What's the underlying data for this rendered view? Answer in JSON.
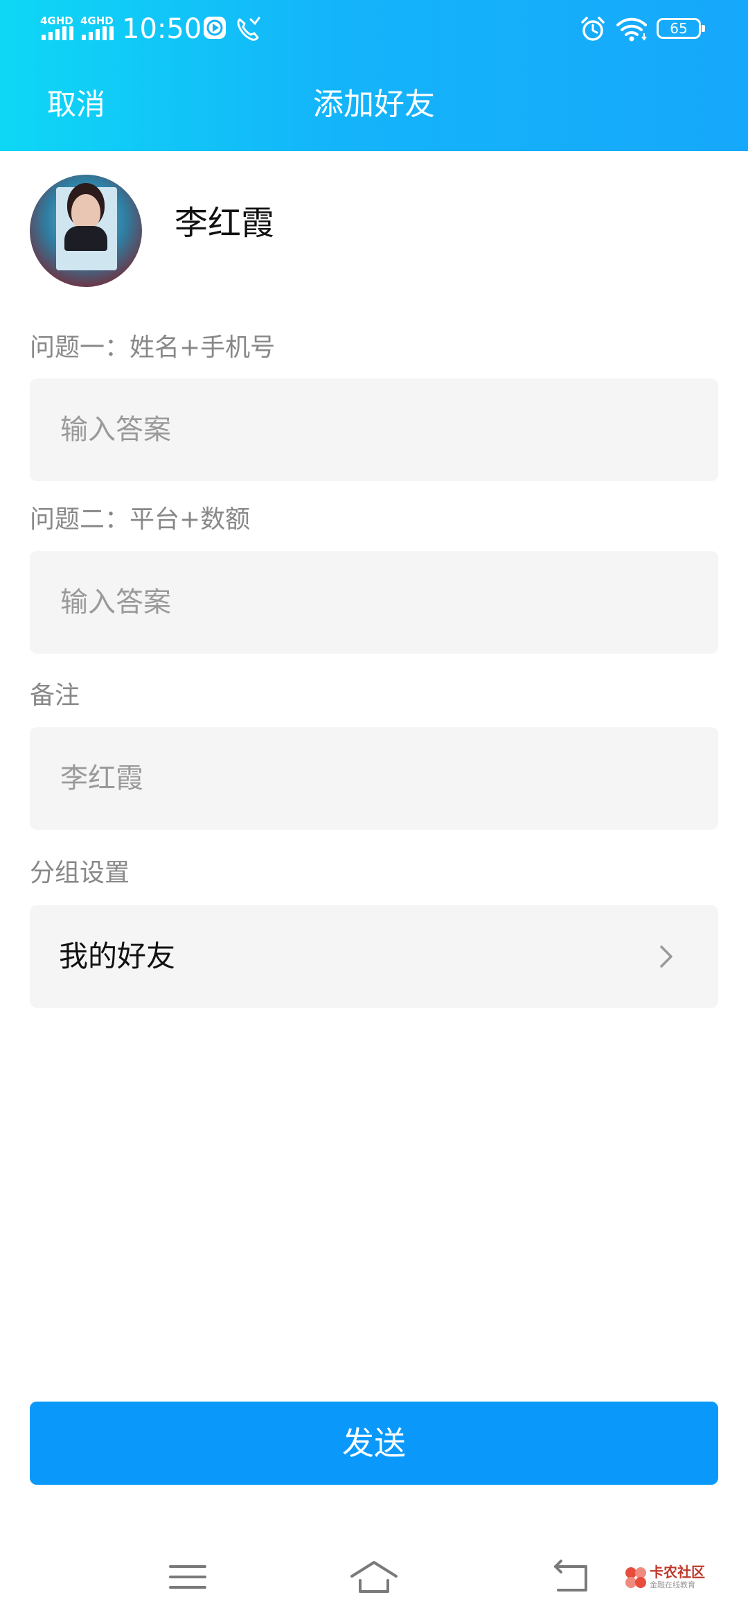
{
  "status_bar": {
    "network1": "4GHD",
    "network2": "4GHD",
    "time": "10:50",
    "battery": "65"
  },
  "header": {
    "cancel_label": "取消",
    "title": "添加好友"
  },
  "profile": {
    "name": "李红霞"
  },
  "form": {
    "q1_label": "问题一：姓名+手机号",
    "q1_placeholder": "输入答案",
    "q2_label": "问题二：平台+数额",
    "q2_placeholder": "输入答案",
    "remark_label": "备注",
    "remark_placeholder": "李红霞",
    "group_label": "分组设置",
    "group_value": "我的好友"
  },
  "send_label": "发送",
  "watermark": {
    "title": "卡农社区",
    "subtitle": "金融在线教育"
  },
  "colors": {
    "header_start": "#0ed7f5",
    "header_end": "#16a8fb",
    "send_button": "#0a99fb",
    "field_bg": "#f5f5f5"
  }
}
